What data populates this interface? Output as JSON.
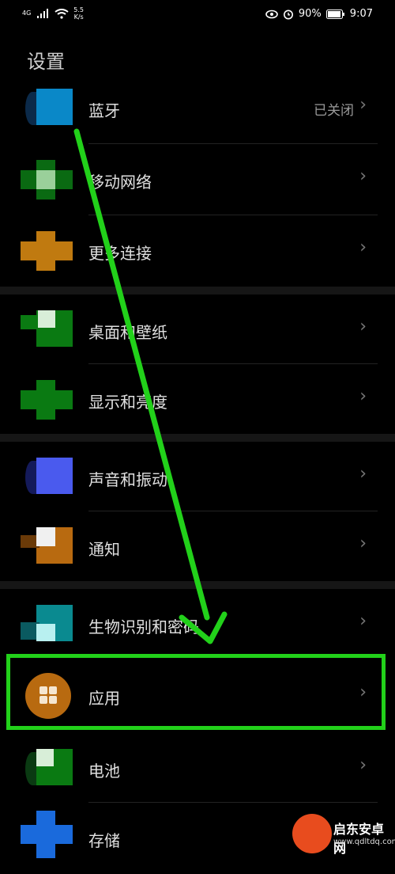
{
  "status_bar": {
    "network": "4G",
    "speed_top": "5.5",
    "speed_bottom": "K/s",
    "battery": "90%",
    "time": "9:07"
  },
  "page_title": "设置",
  "items": [
    {
      "label": "蓝牙",
      "value": "已关闭"
    },
    {
      "label": "移动网络"
    },
    {
      "label": "更多连接"
    },
    {
      "label": "桌面和壁纸"
    },
    {
      "label": "显示和亮度"
    },
    {
      "label": "声音和振动"
    },
    {
      "label": "通知"
    },
    {
      "label": "生物识别和密码"
    },
    {
      "label": "应用"
    },
    {
      "label": "电池"
    },
    {
      "label": "存储"
    }
  ],
  "colors": {
    "highlight": "#22d11a",
    "arrow": "#22d11a"
  },
  "watermark": {
    "title": "启东安卓网",
    "url": "www.qdltdq.com"
  }
}
